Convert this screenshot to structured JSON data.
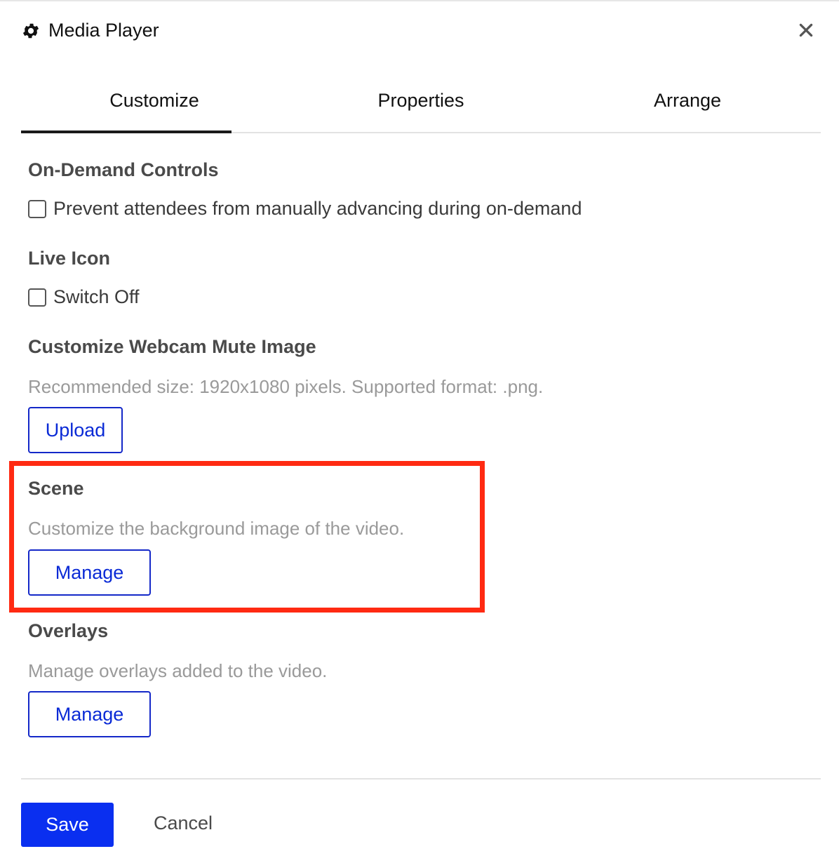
{
  "header": {
    "title": "Media Player",
    "icon": "gear-icon",
    "close_icon": "close-icon"
  },
  "tabs": [
    {
      "label": "Customize",
      "active": true
    },
    {
      "label": "Properties",
      "active": false
    },
    {
      "label": "Arrange",
      "active": false
    }
  ],
  "on_demand": {
    "title": "On-Demand Controls",
    "checkbox_label": "Prevent attendees from manually advancing during on-demand",
    "checked": false
  },
  "live_icon": {
    "title": "Live Icon",
    "checkbox_label": "Switch Off",
    "checked": false
  },
  "webcam": {
    "title": "Customize Webcam Mute Image",
    "description": "Recommended size: 1920x1080 pixels. Supported format: .png.",
    "button_label": "Upload"
  },
  "scene": {
    "title": "Scene",
    "description": "Customize the background image of the video.",
    "button_label": "Manage"
  },
  "overlays": {
    "title": "Overlays",
    "description": "Manage overlays added to the video.",
    "button_label": "Manage"
  },
  "footer": {
    "save_label": "Save",
    "cancel_label": "Cancel"
  },
  "colors": {
    "accent": "#0a2ff0",
    "link_blue": "#0a2ad6",
    "highlight": "#ff2a12"
  }
}
